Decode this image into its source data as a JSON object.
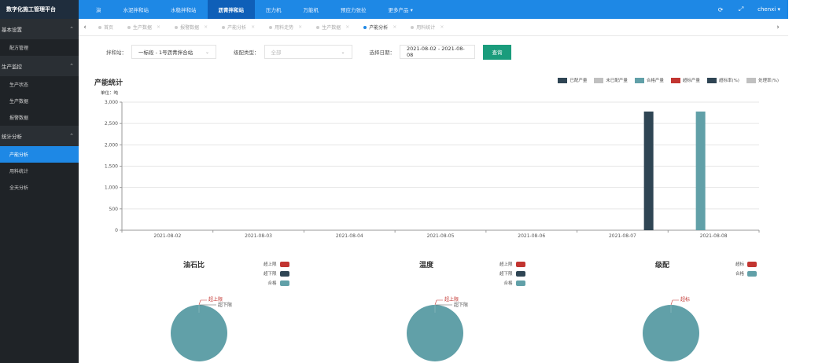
{
  "brand": "数字化施工管理平台",
  "nav": [
    {
      "label": "演",
      "active": false
    },
    {
      "label": "水泥拌和站",
      "active": false
    },
    {
      "label": "水稳拌和站",
      "active": false
    },
    {
      "label": "沥青拌和站",
      "active": true
    },
    {
      "label": "压力机",
      "active": false
    },
    {
      "label": "万能机",
      "active": false
    },
    {
      "label": "预应力张拉",
      "active": false
    },
    {
      "label": "更多产品 ▾",
      "active": false
    }
  ],
  "user": "chenxi",
  "sidebar": {
    "groups": [
      {
        "label": "基本设置",
        "items": [
          {
            "label": "配方管理",
            "active": false
          }
        ]
      },
      {
        "label": "生产监控",
        "items": [
          {
            "label": "生产状态",
            "active": false
          },
          {
            "label": "生产数据",
            "active": false
          },
          {
            "label": "报警数据",
            "active": false
          }
        ]
      },
      {
        "label": "统计分析",
        "items": [
          {
            "label": "产能分析",
            "active": true
          },
          {
            "label": "用料统计",
            "active": false
          },
          {
            "label": "全天分析",
            "active": false
          }
        ]
      }
    ]
  },
  "tabs": [
    {
      "label": "首页",
      "active": false,
      "closable": false
    },
    {
      "label": "生产数据",
      "active": false,
      "closable": true
    },
    {
      "label": "报警数据",
      "active": false,
      "closable": true
    },
    {
      "label": "产能分析",
      "active": false,
      "closable": true
    },
    {
      "label": "用料走势",
      "active": false,
      "closable": true
    },
    {
      "label": "生产数据",
      "active": false,
      "closable": true
    },
    {
      "label": "产能分析",
      "active": true,
      "closable": true
    },
    {
      "label": "用料统计",
      "active": false,
      "closable": true
    }
  ],
  "filter": {
    "station_label": "拌和站：",
    "station_value": "一标段 - 1号沥青拌合站",
    "grade_label": "级配类型：",
    "grade_placeholder": "全部",
    "date_label": "选择日期：",
    "date_value": "2021-08-02 - 2021-08-08",
    "query_button": "查询"
  },
  "colors": {
    "accent": "#1e88e5",
    "dark": "#2f4554",
    "light": "#c0c0c0",
    "teal": "#61a0a8",
    "red": "#c23531",
    "query": "#1a9c7c"
  },
  "chart_data": {
    "type": "bar",
    "title": "产能统计",
    "unit_label": "单位：吨",
    "categories": [
      "2021-08-02",
      "2021-08-03",
      "2021-08-04",
      "2021-08-05",
      "2021-08-06",
      "2021-08-07",
      "2021-08-08"
    ],
    "ylim": [
      0,
      3000
    ],
    "yticks": [
      0,
      500,
      1000,
      1500,
      2000,
      2500,
      3000
    ],
    "ytick_labels": [
      "0",
      "500",
      "1,000",
      "1,500",
      "2,000",
      "2,500",
      "3,000"
    ],
    "grid": true,
    "legend_position": "top-right",
    "series": [
      {
        "name": "已配产量",
        "color": "#2f4554",
        "values": [
          0,
          0,
          0,
          0,
          0,
          0,
          2780
        ]
      },
      {
        "name": "未已配产量",
        "color": "#c0c0c0",
        "values": [
          0,
          0,
          0,
          0,
          0,
          0,
          0
        ]
      },
      {
        "name": "合格产量",
        "color": "#61a0a8",
        "values": [
          0,
          0,
          0,
          0,
          0,
          0,
          2780
        ]
      },
      {
        "name": "超标产量",
        "color": "#c23531",
        "values": [
          0,
          0,
          0,
          0,
          0,
          0,
          0
        ]
      },
      {
        "name": "超标率(%)",
        "color": "#2f4554",
        "values": [
          0,
          0,
          0,
          0,
          0,
          0,
          0
        ]
      },
      {
        "name": "处理率(%)",
        "color": "#c0c0c0",
        "values": [
          0,
          0,
          0,
          0,
          0,
          0,
          0
        ]
      }
    ]
  },
  "pies": [
    {
      "title": "油石比",
      "legend": [
        {
          "name": "超上限",
          "color": "#c23531"
        },
        {
          "name": "超下限",
          "color": "#2f4554"
        },
        {
          "name": "合格",
          "color": "#61a0a8"
        }
      ],
      "labels": [
        {
          "text": "超上限",
          "color": "#c23531"
        },
        {
          "text": "超下限",
          "color": "#555555"
        }
      ]
    },
    {
      "title": "温度",
      "legend": [
        {
          "name": "超上限",
          "color": "#c23531"
        },
        {
          "name": "超下限",
          "color": "#2f4554"
        },
        {
          "name": "合格",
          "color": "#61a0a8"
        }
      ],
      "labels": [
        {
          "text": "超上限",
          "color": "#c23531"
        },
        {
          "text": "超下限",
          "color": "#555555"
        }
      ]
    },
    {
      "title": "级配",
      "legend": [
        {
          "name": "超标",
          "color": "#c23531"
        },
        {
          "name": "合格",
          "color": "#61a0a8"
        }
      ],
      "labels": [
        {
          "text": "超标",
          "color": "#c23531"
        }
      ]
    }
  ]
}
